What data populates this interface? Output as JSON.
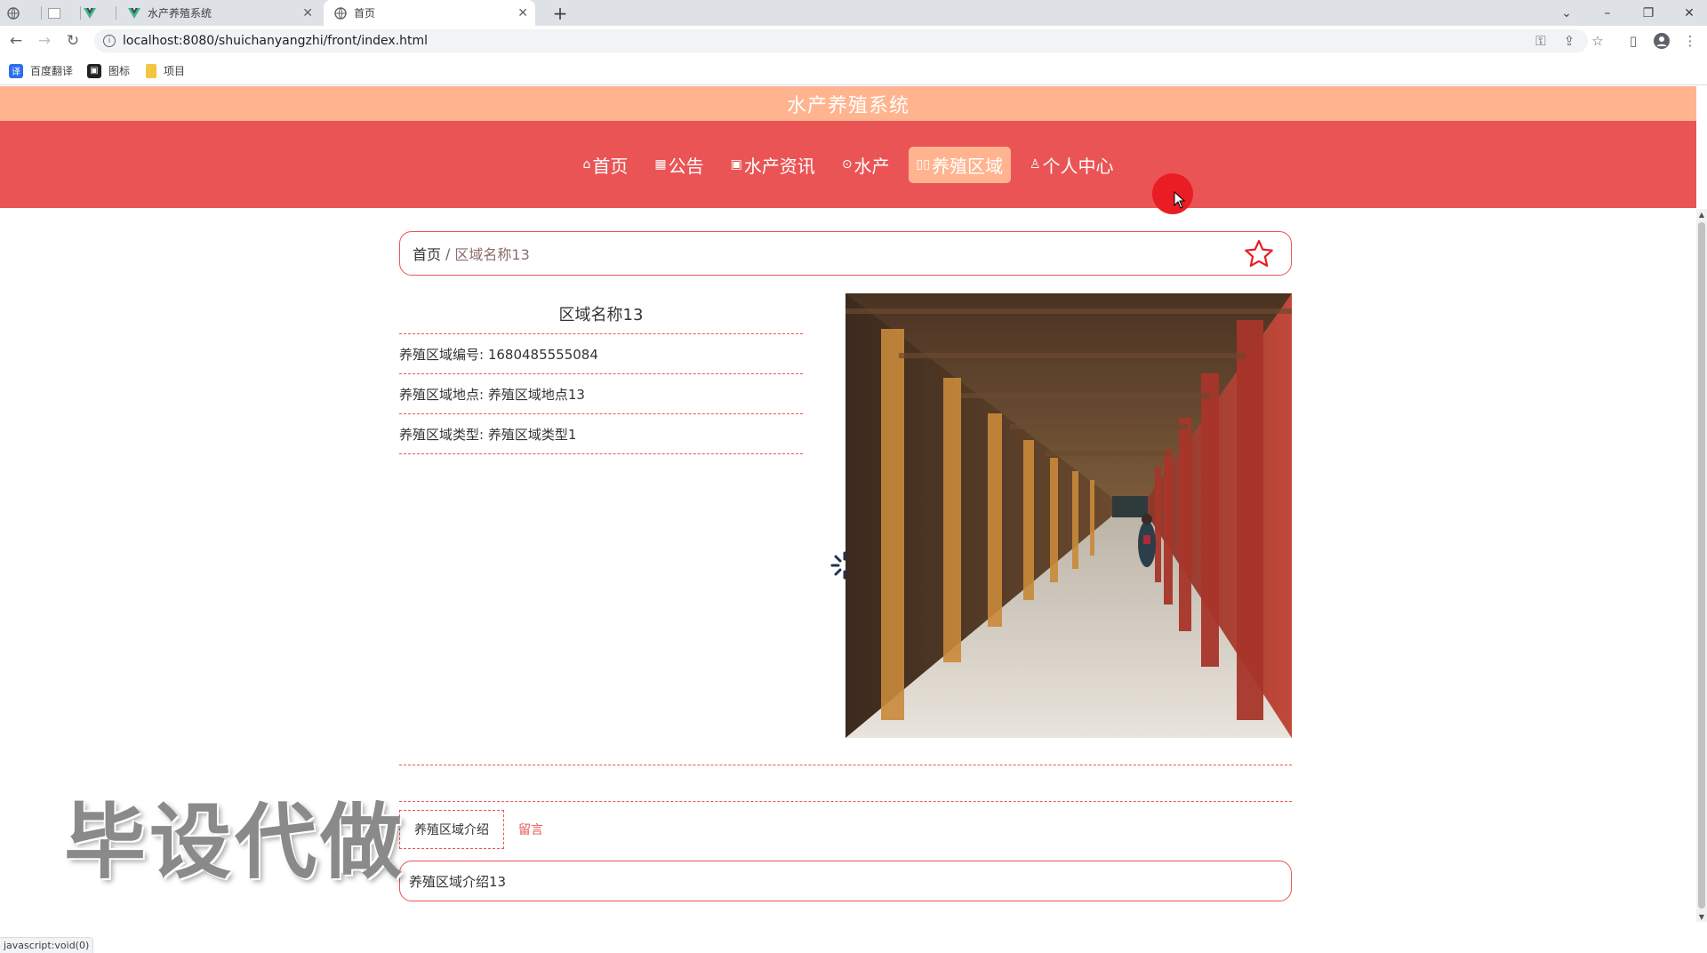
{
  "browser": {
    "tabs": [
      {
        "title": "",
        "icon": "globe-icon"
      },
      {
        "title": "",
        "icon": "blank-page-icon"
      },
      {
        "title": "",
        "icon": "vue-logo-icon"
      },
      {
        "title": "水产养殖系统",
        "icon": "vue-logo-icon"
      },
      {
        "title": "首页",
        "icon": "globe-icon",
        "active": true
      }
    ],
    "url": "localhost:8080/shuichanyangzhi/front/index.html",
    "bookmarks": [
      {
        "label": "百度翻译",
        "icon": "translate-icon",
        "color": "#2b6ef2"
      },
      {
        "label": "图标",
        "icon": "image-icon",
        "color": "#222222"
      },
      {
        "label": "项目",
        "icon": "folder-icon",
        "color": "#f4c542"
      }
    ],
    "status_link": "javascript:void(0)"
  },
  "site": {
    "title": "水产养殖系统",
    "nav": [
      {
        "label": "首页",
        "icon": "home-icon",
        "glyph": "⌂"
      },
      {
        "label": "公告",
        "icon": "notice-icon",
        "glyph": "▦"
      },
      {
        "label": "水产资讯",
        "icon": "grid-icon",
        "glyph": "▣"
      },
      {
        "label": "水产",
        "icon": "fish-icon",
        "glyph": "⊙"
      },
      {
        "label": "养殖区域",
        "icon": "area-icon",
        "glyph": "▯▯",
        "active": true
      },
      {
        "label": "个人中心",
        "icon": "user-icon",
        "glyph": "♙"
      }
    ]
  },
  "breadcrumb": {
    "home": "首页",
    "separator": "/",
    "current": "区域名称13"
  },
  "detail": {
    "name": "区域名称13",
    "rows": [
      "养殖区域编号: 1680485555084",
      "养殖区域地点: 养殖区域地点13",
      "养殖区域类型: 养殖区域类型1"
    ]
  },
  "tabs": {
    "intro": "养殖区域介绍",
    "comments": "留言"
  },
  "intro_text": "养殖区域介绍13",
  "watermark": "毕设代做",
  "colors": {
    "header_top": "#ffb48f",
    "nav_bg": "#ea5455",
    "accent": "#ea5455"
  }
}
